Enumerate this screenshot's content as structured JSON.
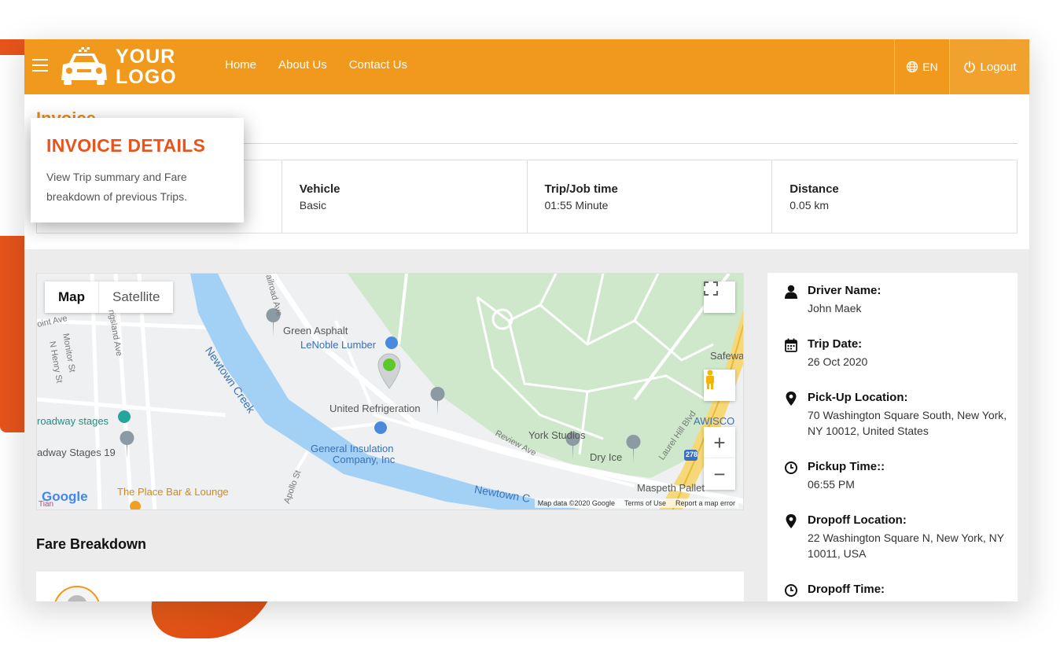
{
  "header": {
    "logo_line1": "YOUR",
    "logo_line2": "LOGO",
    "nav": [
      "Home",
      "About Us",
      "Contact Us"
    ],
    "language": "EN",
    "logout_label": "Logout",
    "brand_color": "#f0991c"
  },
  "invoice": {
    "heading": "Invoice",
    "stats": [
      {
        "label": "Vehicle",
        "value": "Basic"
      },
      {
        "label": "Trip/Job time",
        "value": "01:55 Minute"
      },
      {
        "label": "Distance",
        "value": "0.05 km"
      }
    ]
  },
  "tooltip": {
    "title": "INVOICE DETAILS",
    "text": "View Trip summary and Fare breakdown of previous Trips."
  },
  "map": {
    "toggle": [
      "Map",
      "Satellite"
    ],
    "labels": {
      "green_asphalt": "Green Asphalt",
      "lenoble": "LeNoble Lumber",
      "united_ref": "United Refrigeration",
      "general_ins_1": "General Insulation",
      "general_ins_2": "Company, Inc",
      "newtown_creek": "Newtown Creek",
      "newtown_2": "Newtown C",
      "york_studios": "York Studios",
      "dry_ice": "Dry Ice",
      "maspeth": "Maspeth Pallet",
      "safeway": "Safewa",
      "awisco": "AWISCO",
      "broadway_stages": "roadway stages",
      "broadway_stages_19": "adway Stages 19",
      "place_bar": "The Place Bar & Lounge",
      "review_ave": "Review Ave",
      "laurel_hill": "Laurel Hill Blvd",
      "point_ave": "oint Ave",
      "monitor_st": "Monitor St",
      "n_henry": "N Henry St",
      "kingsland": "ngsland Ave",
      "railroad": "ailroad Ave",
      "apollo": "Apollo St",
      "route": "278",
      "google": "Google",
      "tian": "Tian"
    },
    "footer": [
      "Map data ©2020 Google",
      "Terms of Use",
      "Report a map error"
    ]
  },
  "fare": {
    "title": "Fare Breakdown"
  },
  "details": [
    {
      "icon": "user-icon",
      "label": "Driver Name:",
      "value": "John Maek"
    },
    {
      "icon": "calendar-icon",
      "label": "Trip Date:",
      "value": "26 Oct 2020"
    },
    {
      "icon": "location-pin-icon",
      "label": "Pick-Up Location:",
      "value": "70 Washington Square South, New York, NY 10012, United States"
    },
    {
      "icon": "clock-icon",
      "label": "Pickup Time::",
      "value": "06:55 PM"
    },
    {
      "icon": "location-pin-icon",
      "label": "Dropoff Location:",
      "value": "22 Washington Square N, New York, NY 10011, USA"
    },
    {
      "icon": "clock-icon",
      "label": "Dropoff Time:",
      "value": ""
    }
  ]
}
